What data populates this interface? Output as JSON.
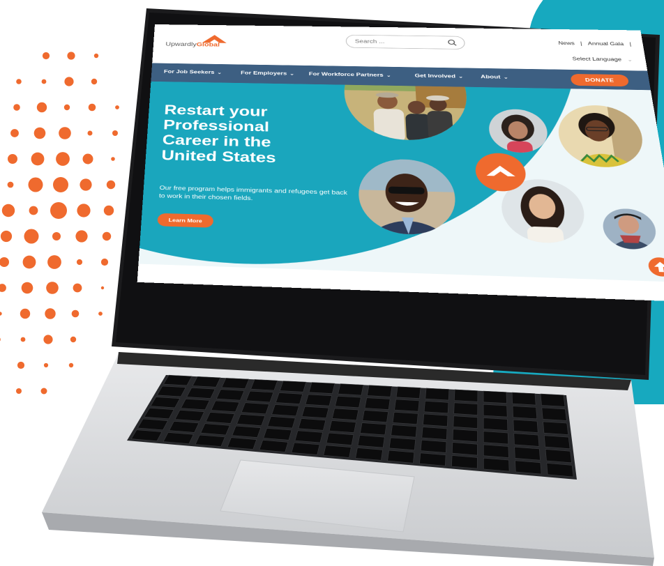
{
  "site": {
    "logo": {
      "name_part1": "Upwardly",
      "name_part2": "Global"
    },
    "search": {
      "placeholder": "Search ..."
    },
    "toplinks": {
      "news": "News",
      "separator": "|",
      "gala": "Annual Gala",
      "separator2": "|"
    },
    "language": {
      "label": "Select Language",
      "chevron": "⌄"
    },
    "nav": [
      {
        "label": "For Job Seekers"
      },
      {
        "label": "For Employers"
      },
      {
        "label": "For Workforce Partners"
      },
      {
        "label": "Get Involved"
      },
      {
        "label": "About"
      }
    ],
    "nav_caret": "⌄",
    "donate": "DONATE",
    "hero": {
      "title_line1": "Restart your",
      "title_line2": "Professional",
      "title_line3": "Career in the",
      "title_line4": "United States",
      "subtitle": "Our free program helps immigrants and refugees get back to work in their chosen fields.",
      "cta": "Learn More"
    }
  },
  "colors": {
    "brand_orange": "#ef6a2e",
    "nav_blue": "#3d5f82",
    "hero_teal": "#1aa6bd",
    "page_teal": "#17a9bf"
  },
  "icons": {
    "search": "search-icon",
    "scroll_top": "arrow-up-icon",
    "logo_mark": "chevron-up-icon"
  }
}
